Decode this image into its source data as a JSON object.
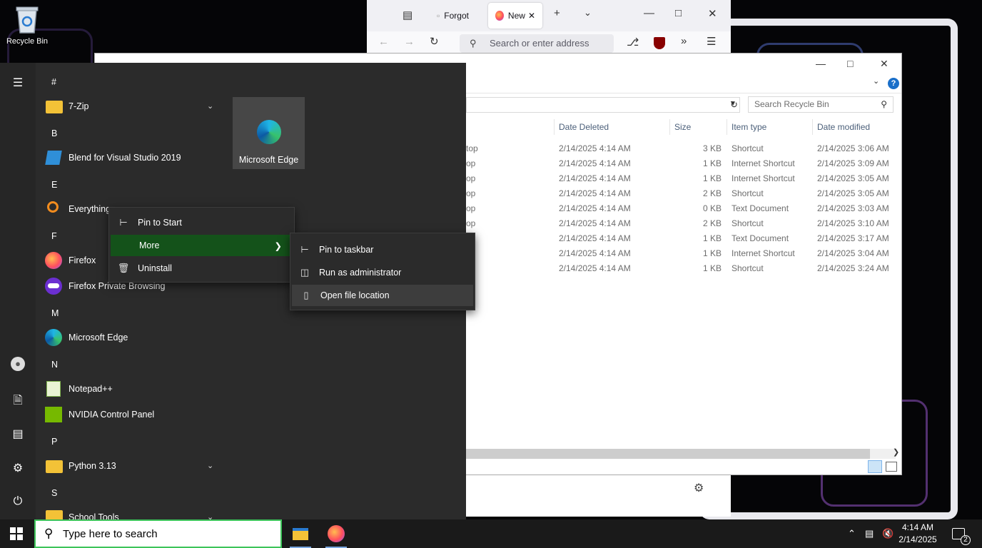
{
  "desktop": {
    "recycle_bin_label": "Recycle Bin"
  },
  "firefox": {
    "tabs": [
      {
        "label": "Forgot"
      },
      {
        "label": "New"
      }
    ],
    "address_placeholder": "Search or enter address"
  },
  "explorer": {
    "search_placeholder": "Search Recycle Bin",
    "columns": [
      "Date Deleted",
      "Size",
      "Item type",
      "Date modified"
    ],
    "rows": [
      {
        "name": "top",
        "date_deleted": "2/14/2025 4:14 AM",
        "size": "3 KB",
        "type": "Shortcut",
        "modified": "2/14/2025 3:06 AM"
      },
      {
        "name": "op",
        "date_deleted": "2/14/2025 4:14 AM",
        "size": "1 KB",
        "type": "Internet Shortcut",
        "modified": "2/14/2025 3:09 AM"
      },
      {
        "name": "op",
        "date_deleted": "2/14/2025 4:14 AM",
        "size": "1 KB",
        "type": "Internet Shortcut",
        "modified": "2/14/2025 3:05 AM"
      },
      {
        "name": "op",
        "date_deleted": "2/14/2025 4:14 AM",
        "size": "2 KB",
        "type": "Shortcut",
        "modified": "2/14/2025 3:05 AM"
      },
      {
        "name": "op",
        "date_deleted": "2/14/2025 4:14 AM",
        "size": "0 KB",
        "type": "Text Document",
        "modified": "2/14/2025 3:03 AM"
      },
      {
        "name": "op",
        "date_deleted": "2/14/2025 4:14 AM",
        "size": "2 KB",
        "type": "Shortcut",
        "modified": "2/14/2025 3:10 AM"
      },
      {
        "name": "",
        "date_deleted": "2/14/2025 4:14 AM",
        "size": "1 KB",
        "type": "Text Document",
        "modified": "2/14/2025 3:17 AM"
      },
      {
        "name": "",
        "date_deleted": "2/14/2025 4:14 AM",
        "size": "1 KB",
        "type": "Internet Shortcut",
        "modified": "2/14/2025 3:04 AM"
      },
      {
        "name": "",
        "date_deleted": "2/14/2025 4:14 AM",
        "size": "1 KB",
        "type": "Shortcut",
        "modified": "2/14/2025 3:24 AM"
      }
    ]
  },
  "start_menu": {
    "letters": [
      "#",
      "B",
      "E",
      "F",
      "M",
      "N",
      "P",
      "S"
    ],
    "apps": {
      "7zip": "7-Zip",
      "blend": "Blend for Visual Studio 2019",
      "everything": "Everything",
      "firefox": "Firefox",
      "firefox_private": "Firefox Private Browsing",
      "edge": "Microsoft Edge",
      "notepadpp": "Notepad++",
      "nvidia": "NVIDIA Control Panel",
      "python": "Python 3.13",
      "school": "School Tools"
    },
    "tile_label": "Microsoft Edge"
  },
  "context_menu": {
    "pin_to_start": "Pin to Start",
    "more": "More",
    "uninstall": "Uninstall"
  },
  "submenu": {
    "pin_to_taskbar": "Pin to taskbar",
    "run_as_admin": "Run as administrator",
    "open_file_location": "Open file location"
  },
  "taskbar": {
    "search_placeholder": "Type here to search",
    "time": "4:14 AM",
    "date": "2/14/2025",
    "notification_count": "2"
  },
  "colors": {
    "start_bg": "#2b2b2b",
    "menu_highlight": "#14521a",
    "search_border": "#3dc45a"
  }
}
